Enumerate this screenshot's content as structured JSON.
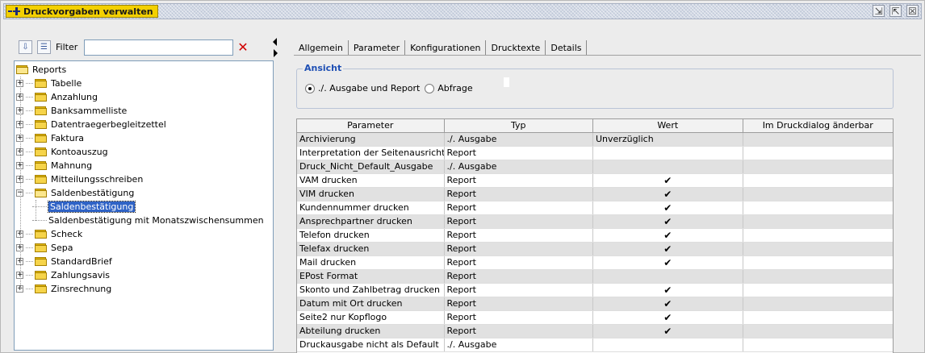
{
  "window": {
    "title": "Druckvorgaben verwalten",
    "controls": [
      "⇲",
      "⇱",
      "☒"
    ]
  },
  "filter": {
    "label": "Filter",
    "value": "",
    "clear_symbol": "✕"
  },
  "tree": {
    "root": "Reports",
    "items": [
      {
        "label": "Tabelle"
      },
      {
        "label": "Anzahlung"
      },
      {
        "label": "Banksammelliste"
      },
      {
        "label": "Datentraegerbegleitzettel"
      },
      {
        "label": "Faktura"
      },
      {
        "label": "Kontoauszug"
      },
      {
        "label": "Mahnung"
      },
      {
        "label": "Mitteilungsschreiben"
      },
      {
        "label": "Saldenbestätigung",
        "expanded": true
      },
      {
        "label": "Saldenbestätigung",
        "child": true,
        "selected": true
      },
      {
        "label": "Saldenbestätigung mit Monatszwischensummen",
        "child": true
      },
      {
        "label": "Scheck"
      },
      {
        "label": "Sepa"
      },
      {
        "label": "StandardBrief"
      },
      {
        "label": "Zahlungsavis"
      },
      {
        "label": "Zinsrechnung"
      }
    ]
  },
  "tabs": [
    {
      "label": "Allgemein"
    },
    {
      "label": "Parameter",
      "active": true
    },
    {
      "label": "Konfigurationen"
    },
    {
      "label": "Drucktexte"
    },
    {
      "label": "Details"
    }
  ],
  "ansicht": {
    "title": "Ansicht",
    "option1": "./. Ausgabe und Report",
    "option2": "Abfrage",
    "selected": "option1"
  },
  "table": {
    "headers": [
      "Parameter",
      "Typ",
      "Wert",
      "Im Druckdialog änderbar"
    ],
    "check_symbol": "✔",
    "rows": [
      {
        "param": "Archivierung",
        "typ": "./. Ausgabe",
        "wert": "Unverzüglich",
        "check": false
      },
      {
        "param": "Interpretation der Seitenausricht...",
        "typ": "Report",
        "wert": "",
        "check": false
      },
      {
        "param": "Druck_Nicht_Default_Ausgabe",
        "typ": "./. Ausgabe",
        "wert": "",
        "check": false
      },
      {
        "param": "VAM drucken",
        "typ": "Report",
        "wert": "",
        "check": true
      },
      {
        "param": "VIM drucken",
        "typ": "Report",
        "wert": "",
        "check": true
      },
      {
        "param": "Kundennummer drucken",
        "typ": "Report",
        "wert": "",
        "check": true
      },
      {
        "param": "Ansprechpartner drucken",
        "typ": "Report",
        "wert": "",
        "check": true
      },
      {
        "param": "Telefon drucken",
        "typ": "Report",
        "wert": "",
        "check": true
      },
      {
        "param": "Telefax drucken",
        "typ": "Report",
        "wert": "",
        "check": true
      },
      {
        "param": "Mail drucken",
        "typ": "Report",
        "wert": "",
        "check": true
      },
      {
        "param": "EPost Format",
        "typ": "Report",
        "wert": "",
        "check": false
      },
      {
        "param": "Skonto und Zahlbetrag drucken",
        "typ": "Report",
        "wert": "",
        "check": true
      },
      {
        "param": "Datum mit Ort drucken",
        "typ": "Report",
        "wert": "",
        "check": true
      },
      {
        "param": "Seite2 nur Kopflogo",
        "typ": "Report",
        "wert": "",
        "check": true
      },
      {
        "param": "Abteilung drucken",
        "typ": "Report",
        "wert": "",
        "check": true
      },
      {
        "param": "Druckausgabe nicht als Default",
        "typ": "./. Ausgabe",
        "wert": "",
        "check": false
      }
    ]
  }
}
